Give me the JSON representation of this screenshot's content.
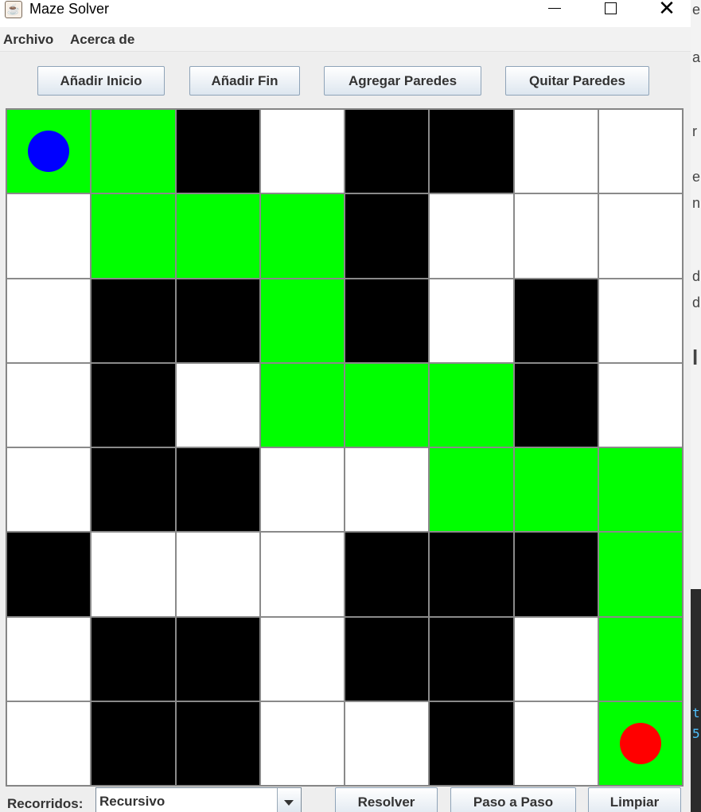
{
  "window": {
    "title": "Maze Solver",
    "app_icon": "java-cup-icon",
    "controls": {
      "minimize": "minimize-icon",
      "maximize": "maximize-icon",
      "close": "close-icon",
      "close_glyph": "✕"
    }
  },
  "menu": {
    "items": [
      "Archivo",
      "Acerca de"
    ]
  },
  "toolbar": {
    "add_start": "Añadir Inicio",
    "add_end": "Añadir Fin",
    "add_walls": "Agregar Paredes",
    "remove_walls": "Quitar Paredes"
  },
  "maze": {
    "rows": 8,
    "cols": 8,
    "colors": {
      "wall": "#000000",
      "open": "#ffffff",
      "path": "#00ff00",
      "start": "#0000ff",
      "end": "#ff0000"
    },
    "grid": [
      "GGBWBBWW",
      "WGGGBWWW",
      "WBBGBWBW",
      "WBWGGGBW",
      "WBBWWGGG",
      "BWWWBBBG",
      "WBBWBBWG",
      "WBBWWBWG"
    ],
    "start": {
      "row": 0,
      "col": 0
    },
    "end": {
      "row": 7,
      "col": 7
    }
  },
  "bottom": {
    "traversal_label": "Recorridos:",
    "traversal_selected": "Recursivo",
    "solve": "Resolver",
    "step_by_step": "Paso a Paso",
    "clear": "Limpiar"
  },
  "background_window_chars": [
    "e",
    "a",
    "r",
    "e",
    "n",
    "d",
    "d",
    "l",
    "t",
    "5"
  ]
}
